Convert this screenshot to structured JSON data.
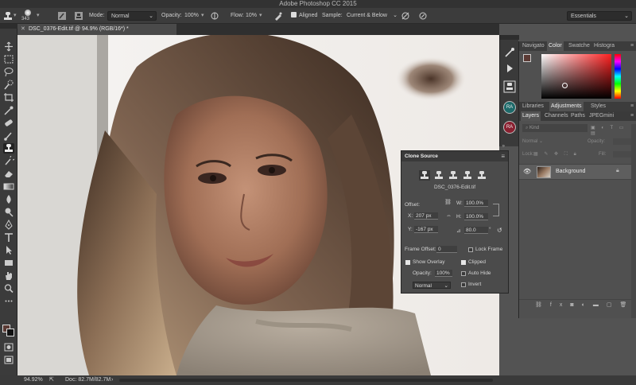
{
  "window": {
    "title": "Adobe Photoshop CC 2015"
  },
  "options": {
    "brush_size": "343",
    "mode_label": "Mode:",
    "mode_value": "Normal",
    "opacity_label": "Opacity:",
    "opacity_value": "100%",
    "flow_label": "Flow:",
    "flow_value": "10%",
    "aligned_label": "Aligned",
    "sample_label": "Sample:",
    "sample_value": "Current & Below",
    "workspace": "Essentials"
  },
  "document": {
    "tab_title": "DSC_0376-Edit.tif @ 94.9% (RGB/16*) *"
  },
  "status": {
    "zoom": "94.92%",
    "doc_size": "Doc: 82.7M/82.7M"
  },
  "color_panel": {
    "tabs": [
      "Navigato",
      "Color",
      "Swatche",
      "Histogra"
    ],
    "active_tab": "Color",
    "foreground": "#5b3a34",
    "background": "#111111"
  },
  "adjust_panel": {
    "tabs": [
      "Libraries",
      "Adjustments",
      "Styles"
    ],
    "active_tab": "Adjustments"
  },
  "layers_panel": {
    "tabs": [
      "Layers",
      "Channels",
      "Paths",
      "JPEGmini"
    ],
    "active_tab": "Layers",
    "filter_placeholder": "Kind",
    "blend_mode": "Normal",
    "opacity_label": "Opacity:",
    "lock_label": "Lock:",
    "fill_label": "Fill:",
    "layers": [
      {
        "name": "Background",
        "visible": true,
        "locked": true
      }
    ]
  },
  "clone_source": {
    "title": "Clone Source",
    "source_file": "DSC_0376-Edit.tif",
    "offset_label": "Offset:",
    "x_label": "X:",
    "x_value": "207 px",
    "y_label": "Y:",
    "y_value": "-167 px",
    "w_label": "W:",
    "w_value": "100.0%",
    "h_label": "H:",
    "h_value": "100.0%",
    "angle_value": "80.0",
    "frame_offset_label": "Frame Offset:",
    "frame_offset_value": "0",
    "lock_frame_label": "Lock Frame",
    "show_overlay_label": "Show Overlay",
    "show_overlay": true,
    "clipped_label": "Clipped",
    "clipped": true,
    "overlay_opacity_label": "Opacity:",
    "overlay_opacity_value": "100%",
    "auto_hide_label": "Auto Hide",
    "auto_hide": false,
    "overlay_mode": "Normal",
    "invert_label": "Invert",
    "invert": false
  },
  "dock": {
    "badge_1": "RA",
    "badge_2": "RA"
  }
}
